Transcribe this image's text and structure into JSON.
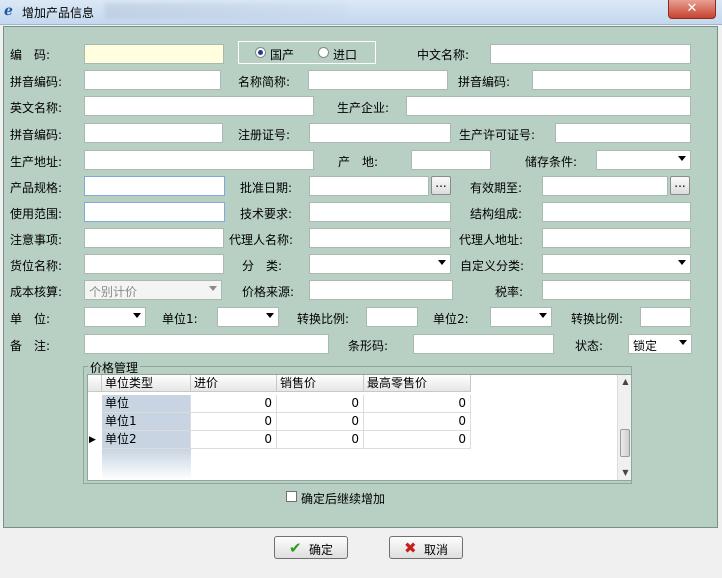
{
  "window": {
    "title": "增加产品信息",
    "close": "✕"
  },
  "labels": {
    "code": "编　码:",
    "cn_name": "中文名称:",
    "pinyin1": "拼音编码:",
    "short_name": "名称简称:",
    "pinyin2": "拼音编码:",
    "en_name": "英文名称:",
    "manufacturer": "生产企业:",
    "pinyin3": "拼音编码:",
    "reg_no": "注册证号:",
    "license_no": "生产许可证号:",
    "address": "生产地址:",
    "origin": "产　地:",
    "storage": "储存条件:",
    "spec": "产品规格:",
    "approval_date": "批准日期:",
    "expiry": "有效期至:",
    "scope": "使用范围:",
    "tech_req": "技术要求:",
    "structure": "结构组成:",
    "notes": "注意事项:",
    "agent_name": "代理人名称:",
    "agent_addr": "代理人地址:",
    "location": "货位名称:",
    "category": "分　类:",
    "custom_category": "自定义分类:",
    "cost": "成本核算:",
    "price_source": "价格来源:",
    "tax": "税率:",
    "unit": "单　位:",
    "unit1": "单位1:",
    "ratio1": "转换比例:",
    "unit2": "单位2:",
    "ratio2": "转换比例:",
    "remark": "备　注:",
    "barcode": "条形码:",
    "status": "状态:"
  },
  "radio": {
    "domestic": "国产",
    "import": "进口",
    "selected": "domestic"
  },
  "combos": {
    "cost_method": "个别计价",
    "status": "锁定"
  },
  "dots": "...",
  "price_group": {
    "title": "价格管理",
    "columns": [
      "单位类型",
      "进价",
      "销售价",
      "最高零售价"
    ],
    "rows": [
      {
        "unit": "单位",
        "cost": "0",
        "sale": "0",
        "max": "0"
      },
      {
        "unit": "单位1",
        "cost": "0",
        "sale": "0",
        "max": "0"
      },
      {
        "unit": "单位2",
        "cost": "0",
        "sale": "0",
        "max": "0"
      }
    ],
    "current_row_marker": "▶"
  },
  "continue_label": "确定后继续增加",
  "buttons": {
    "ok": "确定",
    "ok_icon": "✔",
    "cancel": "取消",
    "cancel_icon": "✖"
  },
  "colors": {
    "panel": "#b8d0c4",
    "ok_icon": "#2e9b1f",
    "cancel_icon": "#c81e1e"
  }
}
